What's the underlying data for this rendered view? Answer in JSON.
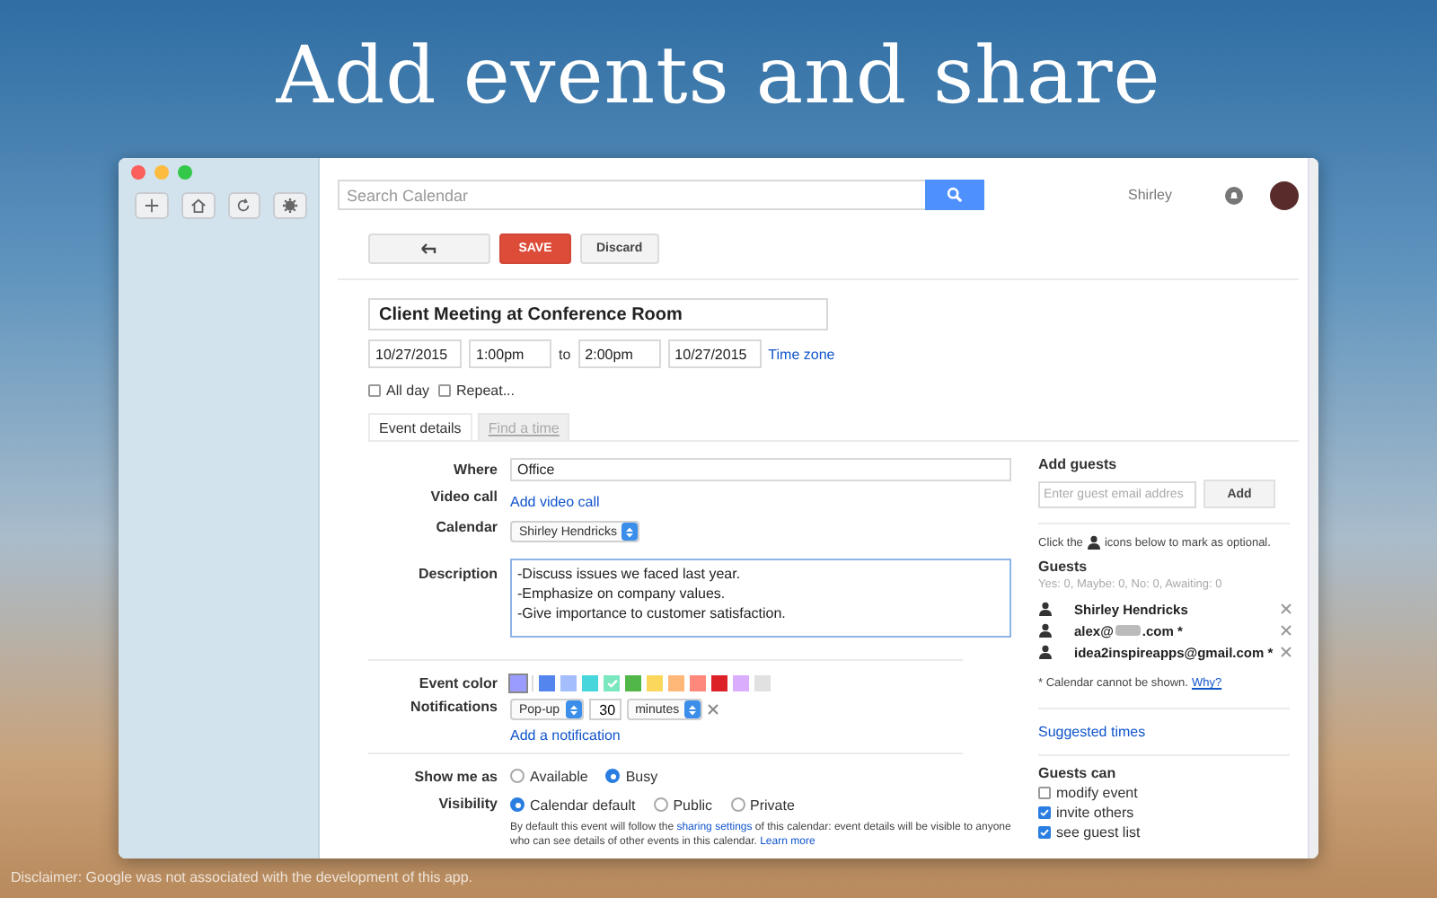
{
  "headline": "Add events and share",
  "toolbar_buttons": [
    {
      "kind": "add"
    },
    {
      "kind": "home"
    },
    {
      "kind": "refresh"
    },
    {
      "kind": "settings"
    }
  ],
  "search": {
    "placeholder": "Search Calendar"
  },
  "user": {
    "name": "Shirley"
  },
  "actions": {
    "save": "SAVE",
    "discard": "Discard"
  },
  "event": {
    "title": "Client Meeting at Conference Room",
    "start_date": "10/27/2015",
    "start_time": "1:00pm",
    "to": "to",
    "end_time": "2:00pm",
    "end_date": "10/27/2015",
    "time_zone": "Time zone"
  },
  "options": [
    {
      "label": "All day",
      "checked": false
    },
    {
      "label": "Repeat...",
      "checked": false
    }
  ],
  "tabs": [
    {
      "label": "Event details",
      "selected": true
    },
    {
      "label": "Find a time",
      "selected": false
    }
  ],
  "where": {
    "label": "Where",
    "value": "Office"
  },
  "video_call": {
    "label": "Video call",
    "link": "Add video call"
  },
  "calendar": {
    "label": "Calendar",
    "value": "Shirley Hendricks"
  },
  "description": {
    "label": "Description",
    "value": "-Discuss issues we faced last year.\n-Emphasize on company values.\n-Give importance to customer satisfaction."
  },
  "event_color": {
    "label": "Event color",
    "default_swatch": {
      "color": "#9a9cff"
    },
    "swatches": [
      {
        "color": "#5484ed",
        "selected": false
      },
      {
        "color": "#a4bdfc",
        "selected": false
      },
      {
        "color": "#46d6db",
        "selected": false
      },
      {
        "color": "#7ae7bf",
        "selected": true
      },
      {
        "color": "#51b749",
        "selected": false
      },
      {
        "color": "#fbd75b",
        "selected": false
      },
      {
        "color": "#ffb878",
        "selected": false
      },
      {
        "color": "#ff887c",
        "selected": false
      },
      {
        "color": "#dc2127",
        "selected": false
      },
      {
        "color": "#dbadff",
        "selected": false
      },
      {
        "color": "#e1e1e1",
        "selected": false
      }
    ]
  },
  "notifications": {
    "label": "Notifications",
    "method": "Pop-up",
    "amount": "30",
    "unit": "minutes",
    "add_link": "Add a notification"
  },
  "show_me_as": {
    "label": "Show me as",
    "options": [
      {
        "label": "Available",
        "selected": false
      },
      {
        "label": "Busy",
        "selected": true
      }
    ]
  },
  "visibility": {
    "label": "Visibility",
    "options": [
      {
        "label": "Calendar default",
        "selected": true
      },
      {
        "label": "Public",
        "selected": false
      },
      {
        "label": "Private",
        "selected": false
      }
    ],
    "note": {
      "before": "By default this event will follow the",
      "link": "sharing settings",
      "after": "of this calendar: event details will be visible to anyone who can see details of other events in this calendar.",
      "more": "Learn more"
    }
  },
  "guests_panel": {
    "title": "Add guests",
    "placeholder": "Enter guest email addres",
    "add": "Add",
    "hint_before": "Click the",
    "hint_after": "icons below to mark as optional.",
    "guests_title": "Guests",
    "counts": "Yes: 0, Maybe: 0, No: 0, Awaiting: 0",
    "guests": [
      {
        "name": "Shirley Hendricks",
        "redacted": false
      },
      {
        "name": "alex@",
        "redacted": true,
        "name_after": ".com *"
      },
      {
        "name": "idea2inspireapps@gmail.com *",
        "redacted": false
      }
    ],
    "note": "* Calendar cannot be shown.",
    "why": "Why?",
    "suggested": "Suggested times",
    "permissions_title": "Guests can",
    "permissions": [
      {
        "label": "modify event",
        "checked": false
      },
      {
        "label": "invite others",
        "checked": true
      },
      {
        "label": "see guest list",
        "checked": true
      }
    ]
  },
  "disclaimer": "Disclaimer: Google was not associated with the development of this app."
}
